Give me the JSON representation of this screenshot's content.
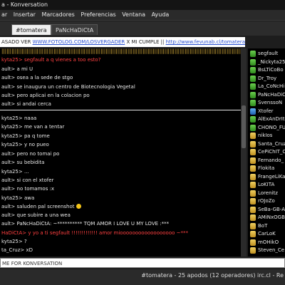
{
  "window": {
    "title": "a - Konversation"
  },
  "menu": [
    "ar",
    "Insertar",
    "Marcadores",
    "Preferencias",
    "Ventana",
    "Ayuda"
  ],
  "tabs": [
    {
      "label": "#tomatera",
      "active": true
    },
    {
      "label": "PaNcHaDiCtA",
      "active": false
    }
  ],
  "topic": {
    "prefix": "ASADO VER ",
    "link1": "WWW.FOTOLOG.COM/LOSVERGADER",
    "middle": " X MI CUMPLE || ",
    "link2": "http://www.fevunab.cl/tomatera"
  },
  "messages": [
    {
      "text": "||||||||||||||||||||||||||||||||||||||||||||||||||||||||||||||||||||||||||||||||||||||||||||||||||||||||||||||||||||||||||||||||||||||||||||||||||||||||||||||||||||| (8)",
      "color": "yellow"
    },
    {
      "text": "kyta25> segfault a q vienes a too esto?",
      "color": "red"
    },
    {
      "text": "ault> a mi U",
      "color": "white"
    },
    {
      "text": "ault> osea a la sede de stgo",
      "color": "white"
    },
    {
      "text": "ault> se inaugura un centro de Biotecnologia Vegetal",
      "color": "white"
    },
    {
      "text": "ault> pero aplicai en la colacion po",
      "color": "white"
    },
    {
      "text": "ault> si andai cerca",
      "color": "white"
    },
    {
      "text": "kyta25> naaa",
      "color": "white"
    },
    {
      "text": "kyta25> me van a tentar",
      "color": "white"
    },
    {
      "text": "kyta25> pa q tome",
      "color": "white"
    },
    {
      "text": "kyta25> y no pueo",
      "color": "white"
    },
    {
      "text": "ault> pero no tomai po",
      "color": "white"
    },
    {
      "text": "ault> su bebidita",
      "color": "white"
    },
    {
      "text": "kyta25> ...",
      "color": "white"
    },
    {
      "text": "ault> si con el xtofer",
      "color": "white"
    },
    {
      "text": "ault> no tomamos :x",
      "color": "white"
    },
    {
      "text": "kyta25> awa",
      "color": "white"
    },
    {
      "text": "ault> saluden pal screenshot",
      "color": "white"
    },
    {
      "text": "ault> que subire a una wea",
      "color": "white"
    },
    {
      "text": "ault> PaNcHaDiCtA: ~********** TQM AMOR I LOVE U MY LOVE :***",
      "color": "white"
    },
    {
      "text": "HaDiCtA> y yo a ti segfault !!!!!!!!!!!!! amor mioooooooooooooooooo ~***",
      "color": "red"
    },
    {
      "text": "kyta25> ?",
      "color": "white"
    },
    {
      "text": "ta_Cruz> xD",
      "color": "white"
    }
  ],
  "nicks": [
    {
      "name": "segfault",
      "type": "op"
    },
    {
      "name": "_Nickyta25",
      "type": "op"
    },
    {
      "name": "BsLTiCoBo",
      "type": "op"
    },
    {
      "name": "Dr_Troy",
      "type": "op"
    },
    {
      "name": "La_CoNcHi",
      "type": "op"
    },
    {
      "name": "PaNcHaDiCt",
      "type": "op"
    },
    {
      "name": "SvenssoN",
      "type": "op"
    },
    {
      "name": "Xtofer",
      "type": "hop"
    },
    {
      "name": "AlExAnDrIt",
      "type": "op"
    },
    {
      "name": "CHONO_FU",
      "type": "op"
    },
    {
      "name": "nikIos",
      "type": "voice"
    },
    {
      "name": "Santa_Cruz",
      "type": "voice"
    },
    {
      "name": "CePiChIT_C",
      "type": "voice"
    },
    {
      "name": "Fernando_",
      "type": "voice"
    },
    {
      "name": "Flokita",
      "type": "voice"
    },
    {
      "name": "FrangeLiKa",
      "type": "voice"
    },
    {
      "name": "LoKITA",
      "type": "voice"
    },
    {
      "name": "Lorenitz",
      "type": "voice"
    },
    {
      "name": "rOJoZo",
      "type": "voice"
    },
    {
      "name": "SeBa-GB-A",
      "type": "voice"
    },
    {
      "name": "AMiNxOGB",
      "type": "voice"
    },
    {
      "name": "BoT",
      "type": "voice"
    },
    {
      "name": "CarLoK",
      "type": "voice"
    },
    {
      "name": "mOHikO",
      "type": "voice"
    },
    {
      "name": "Steven_Ce",
      "type": "voice"
    }
  ],
  "input": {
    "value": "ME FOR KONVERSATION"
  },
  "status": {
    "text": "#tomatera - 25 apodos (12 operadores) irc.cl - Re"
  }
}
